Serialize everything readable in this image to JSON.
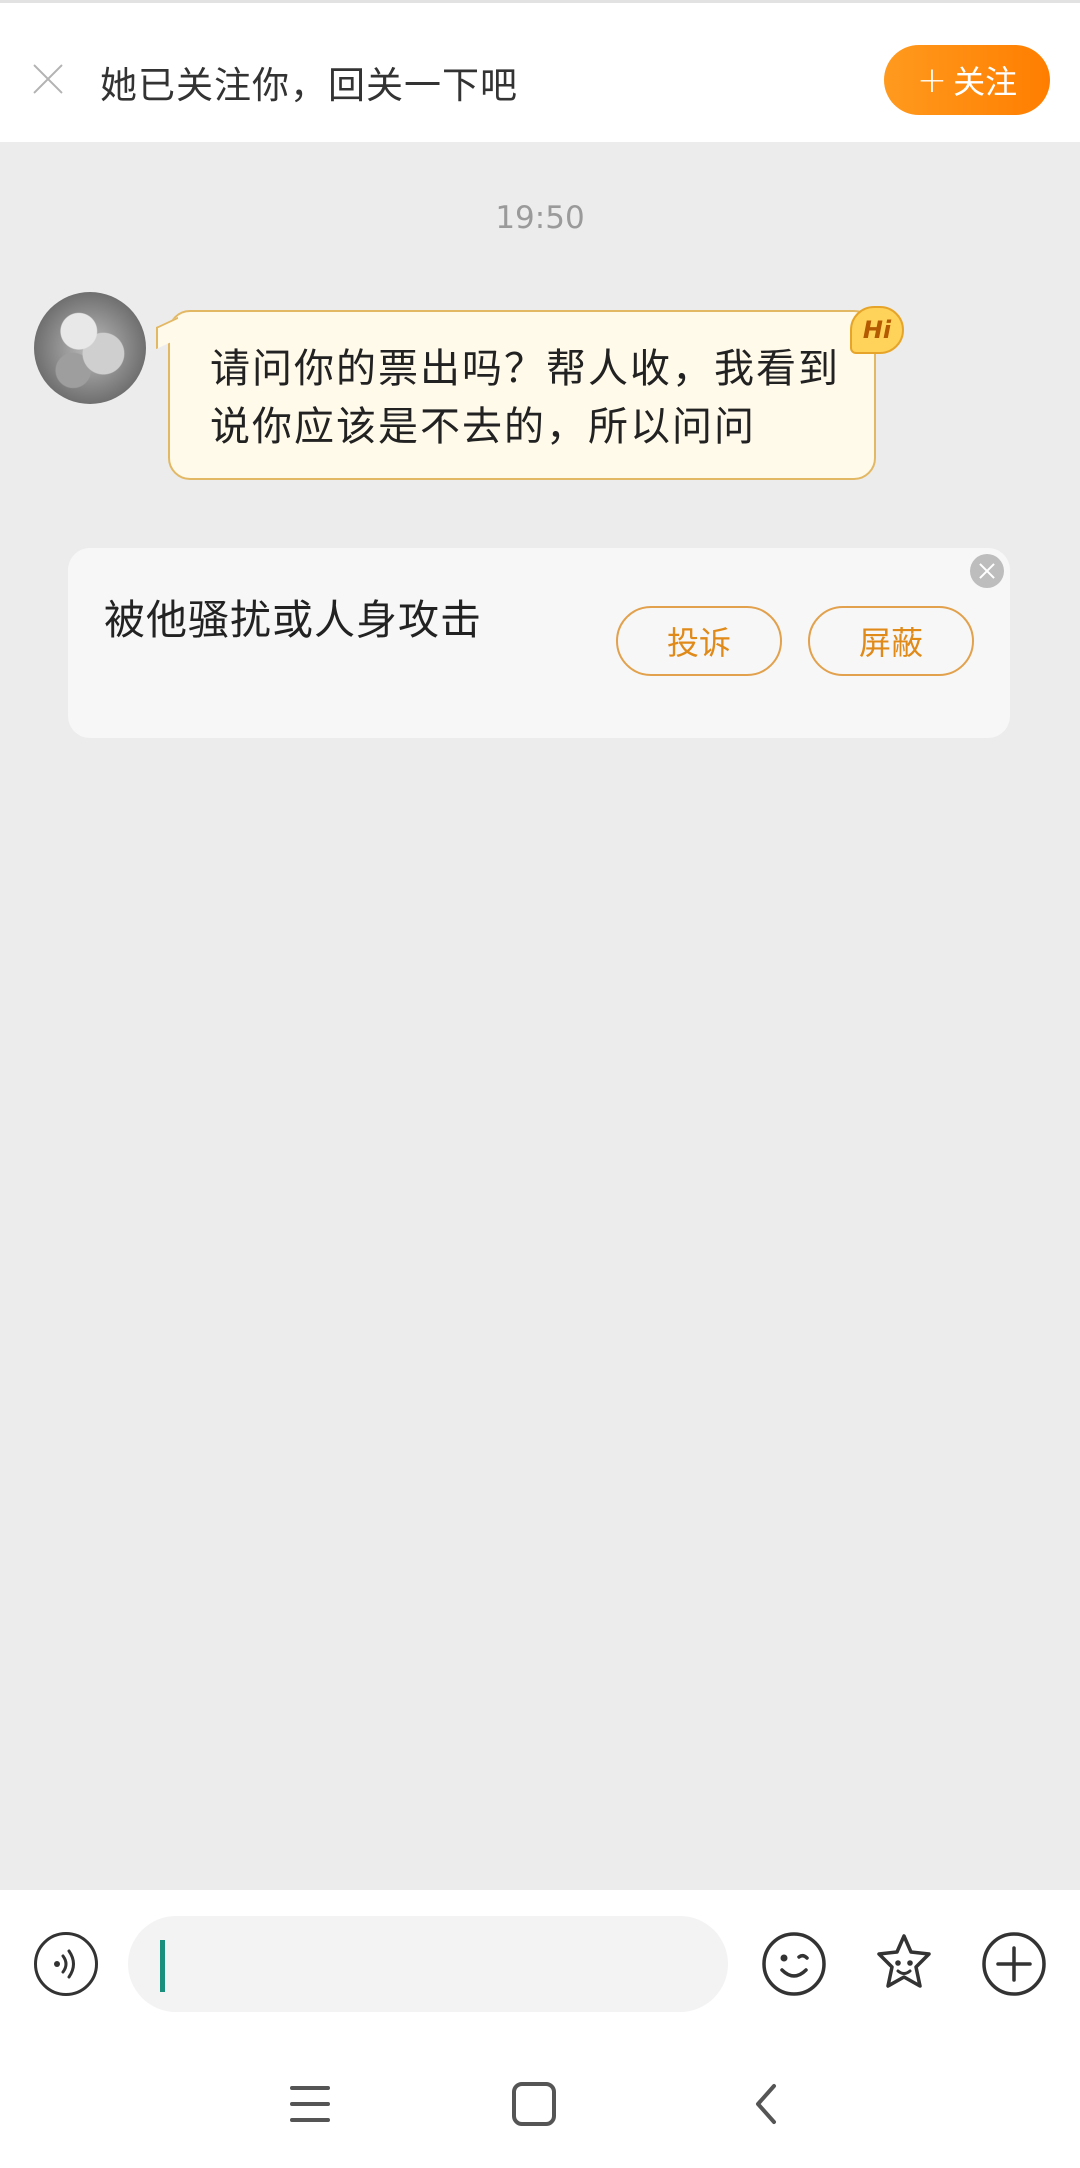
{
  "follow_banner": {
    "text": "她已关注你，回关一下吧",
    "follow_button_plus": "+",
    "follow_button_label": "关注"
  },
  "chat": {
    "timestamp": "19:50",
    "message": {
      "text": "请问你的票出吗？帮人收，我看到说你应该是不去的，所以问问",
      "badge": "Hi"
    }
  },
  "report_card": {
    "title": "被他骚扰或人身攻击",
    "report_label": "投诉",
    "block_label": "屏蔽"
  },
  "input_bar": {
    "placeholder": "",
    "icons": [
      "voice-icon",
      "emoji-icon",
      "sticker-icon",
      "plus-icon"
    ]
  },
  "nav_bar": {
    "icons": [
      "menu-icon",
      "home-icon",
      "back-icon"
    ]
  },
  "colors": {
    "accent": "#ff8a0a",
    "bubble_bg": "#fffaea",
    "bubble_border": "#e3b865",
    "page_bg": "#ececec",
    "cursor": "#1b8f7d"
  }
}
